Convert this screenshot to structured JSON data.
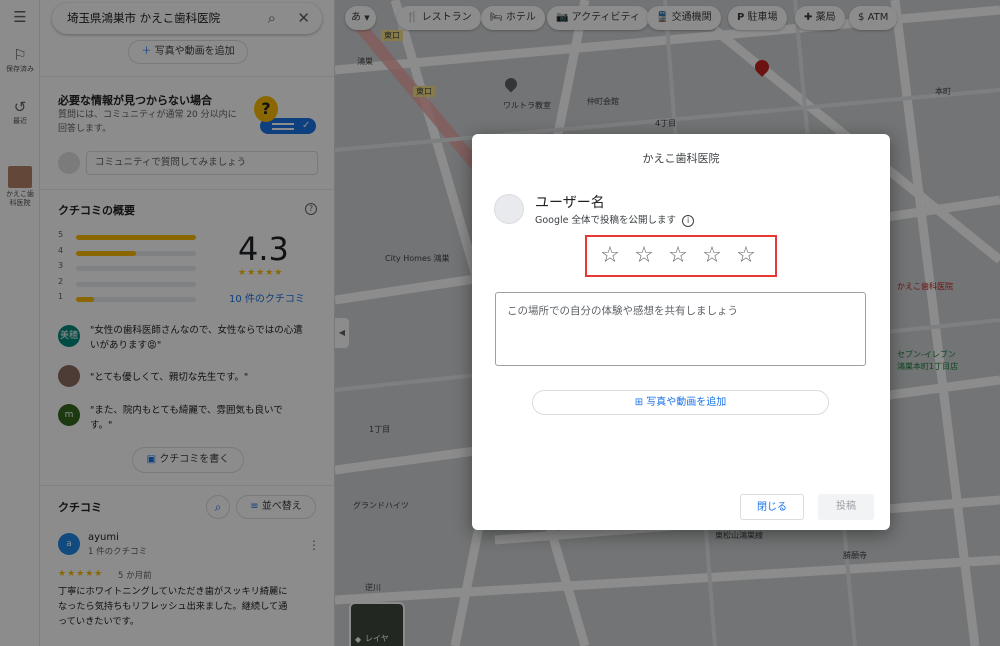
{
  "rail": {
    "menu_icon": "menu-icon",
    "saved_label": "保存済み",
    "recent_label": "最近",
    "place_label": "かえこ歯科医院"
  },
  "search": {
    "value": "埼玉県鴻巣市 かえこ歯科医院"
  },
  "panel": {
    "add_media_label": "写真や動画を追加",
    "missing_info_title": "必要な情報が見つからない場合",
    "missing_info_text": "質問には、コミュニティが通常 20 分以内に回答します。",
    "ask_community_placeholder": "コミュニティで質問してみましょう",
    "summary_title": "クチコミの概要",
    "rating_breakdown": [
      {
        "stars": "5",
        "fraction": 1.0
      },
      {
        "stars": "4",
        "fraction": 0.5
      },
      {
        "stars": "3",
        "fraction": 0.0
      },
      {
        "stars": "2",
        "fraction": 0.0
      },
      {
        "stars": "1",
        "fraction": 0.15
      }
    ],
    "rating_value": "4.3",
    "rating_stars": "★★★★★",
    "review_count_link": "10 件のクチコミ",
    "highlights": [
      {
        "avatar_text": "美穂",
        "avatar_color": "#00897b",
        "line1": "\"女性の歯科医師さんなので、女性ならではの心遣",
        "line2": "いがあります😡\""
      },
      {
        "avatar_text": "",
        "avatar_color": "#8d6e63",
        "line1": "\"とても優しくて、親切な先生です。\"",
        "line2": ""
      },
      {
        "avatar_text": "m",
        "avatar_color": "#33691e",
        "line1": "\"また、院内もとても綺麗で、雰囲気も良いで",
        "line2": "す。\""
      }
    ],
    "write_review_label": "クチコミを書く",
    "reviews_title": "クチコミ",
    "sort_label": "並べ替え",
    "review": {
      "avatar_text": "a",
      "author": "ayumi",
      "meta": "1 件のクチコミ",
      "stars": "★★★★★",
      "when": "5 か月前",
      "text1": "丁寧にホワイトニングしていただき歯がスッキリ綺麗に",
      "text2": "なったら気持ちもリフレッシュ出来ました。継続して通",
      "text3": "っていきたいです。"
    }
  },
  "map": {
    "ime_label": "あ",
    "chips": [
      "レストラン",
      "ホテル",
      "アクティビティ",
      "交通機関",
      "駐車場",
      "薬局",
      "ATM"
    ],
    "labels": [
      "東口",
      "東口",
      "鴻巣",
      "ワルトラ教室",
      "仲町会館",
      "本町",
      "4丁目",
      "City Homes 鴻巣",
      "かえこ歯科医院",
      "セブン-イレブン",
      "鴻巣本町1丁目店",
      "1丁目",
      "グランドハイツ",
      "勝願寺",
      "逆川",
      "東松山鴻巣線"
    ],
    "layer_label": "レイヤ"
  },
  "dialog": {
    "title": "かえこ歯科医院",
    "user_name": "ユーザー名",
    "public_note": "Google 全体で投稿を公開します",
    "stars": [
      "☆",
      "☆",
      "☆",
      "☆",
      "☆"
    ],
    "highlight_color": "#e53935",
    "review_placeholder": "この場所での自分の体験や感想を共有しましょう",
    "add_media_label": "写真や動画を追加",
    "close_label": "閉じる",
    "post_label": "投稿"
  }
}
